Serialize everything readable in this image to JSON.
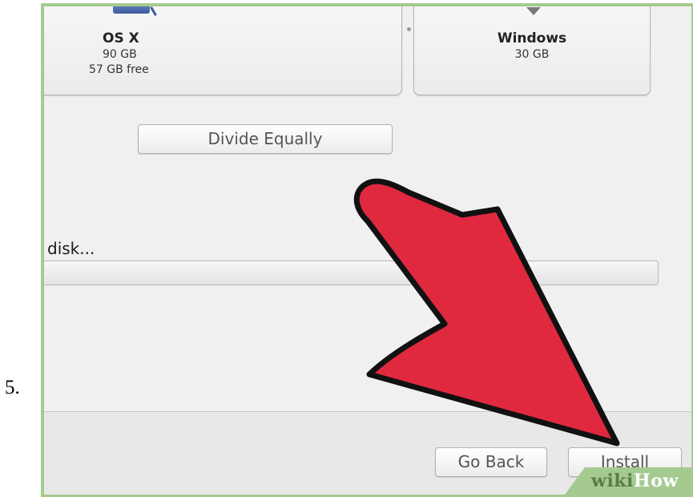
{
  "step": {
    "number": "5."
  },
  "partitions": [
    {
      "name": "OS X",
      "size": "90 GB",
      "free": "57 GB free",
      "icon": "disk-icon"
    },
    {
      "name": "Windows",
      "size": "30 GB",
      "icon": "chevron-down-icon"
    }
  ],
  "buttons": {
    "divide_equally": "Divide Equally",
    "go_back": "Go Back",
    "install": "Install"
  },
  "progress": {
    "status_text": "disk...",
    "fraction": 0
  },
  "annotation": {
    "icon": "red-arrow-icon",
    "color": "#e0293f",
    "outline": "#111111"
  },
  "watermark": {
    "prefix": "wiki",
    "suffix": "How",
    "color": "#a5ca90"
  }
}
